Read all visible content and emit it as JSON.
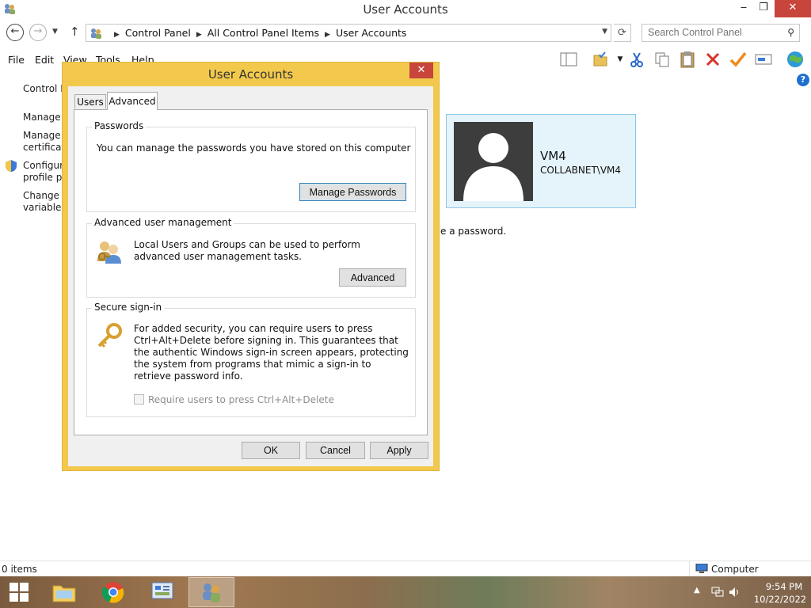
{
  "window": {
    "title": "User Accounts",
    "min_glyph": "‒",
    "max_glyph": "❐",
    "close_glyph": "✕"
  },
  "address_bar": {
    "breadcrumbs": [
      "Control Panel",
      "All Control Panel Items",
      "User Accounts"
    ],
    "search_placeholder": "Search Control Panel"
  },
  "menu": [
    "File",
    "Edit",
    "View",
    "Tools",
    "Help"
  ],
  "left_pane": {
    "links": [
      "Control P",
      "Manage y",
      "Manage y\ncertificate",
      "Configure\nprofile pr",
      "Change r\nvariables"
    ]
  },
  "user_card": {
    "name": "VM4",
    "domain": "COLLABNET\\VM4"
  },
  "background_text": "e a password.",
  "status_bar": {
    "items": "0 items",
    "location": "Computer"
  },
  "dialog": {
    "title": "User Accounts",
    "close_glyph": "✕",
    "tabs": [
      "Users",
      "Advanced"
    ],
    "active_tab": "Advanced",
    "passwords": {
      "title": "Passwords",
      "text": "You can manage the passwords you have stored on this computer",
      "button": "Manage Passwords"
    },
    "advanced_mgmt": {
      "title": "Advanced user management",
      "text": "Local Users and Groups can be used to perform advanced user management tasks.",
      "button": "Advanced"
    },
    "secure_signin": {
      "title": "Secure sign-in",
      "text": "For added security, you can require users to press Ctrl+Alt+Delete before signing in. This guarantees that the authentic Windows sign-in screen appears, protecting the system from programs that mimic a sign-in to retrieve password info.",
      "checkbox_label": "Require users to press Ctrl+Alt+Delete",
      "checked": false
    },
    "buttons": {
      "ok": "OK",
      "cancel": "Cancel",
      "apply": "Apply"
    }
  },
  "taskbar": {
    "apps": [
      "file-explorer",
      "chrome",
      "control-panel",
      "user-accounts"
    ],
    "time": "9:54 PM",
    "date": "10/22/2022"
  },
  "colors": {
    "dialog_frame": "#f2c94c",
    "close_red": "#c7453a",
    "user_card_bg": "#e5f3fb"
  }
}
